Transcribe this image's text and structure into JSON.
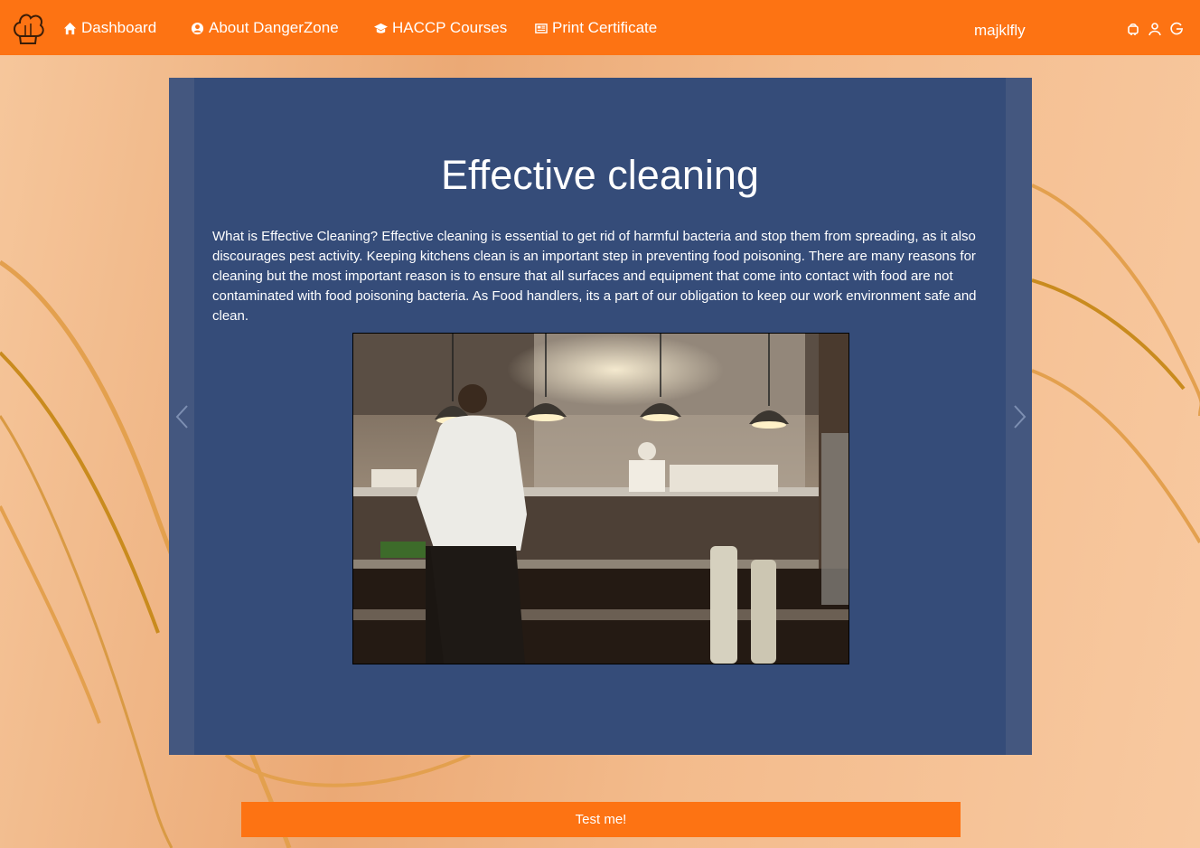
{
  "nav": {
    "home_label": "Dashboard",
    "about_label": "About DangerZone",
    "courses_label": "HACCP Courses",
    "print_label": "Print Certificate",
    "username": "majklfly"
  },
  "slide": {
    "title": "Effective cleaning",
    "text": "What is Effective Cleaning? Effective cleaning is essential to get rid of harmful bacteria and stop them from spreading, as it also discourages pest activity. Keeping kitchens clean is an important step in preventing food poisoning. There are many reasons for cleaning but the most important reason is to ensure that all surfaces and equipment that come into contact with food are not contaminated with food poisoning bacteria. As Food handlers, its a part of our obligation to keep our work environment safe and clean."
  },
  "actions": {
    "test_label": "Test me!"
  },
  "colors": {
    "accent": "#fd7313",
    "panel": "#354c79",
    "panel_edge": "#44577f"
  },
  "icons": [
    "chef-hat-logo-icon",
    "home-icon",
    "user-circle-icon",
    "graduation-cap-icon",
    "newspaper-icon",
    "android-icon",
    "user-icon",
    "logout-icon",
    "chevron-left-icon",
    "chevron-right-icon"
  ]
}
